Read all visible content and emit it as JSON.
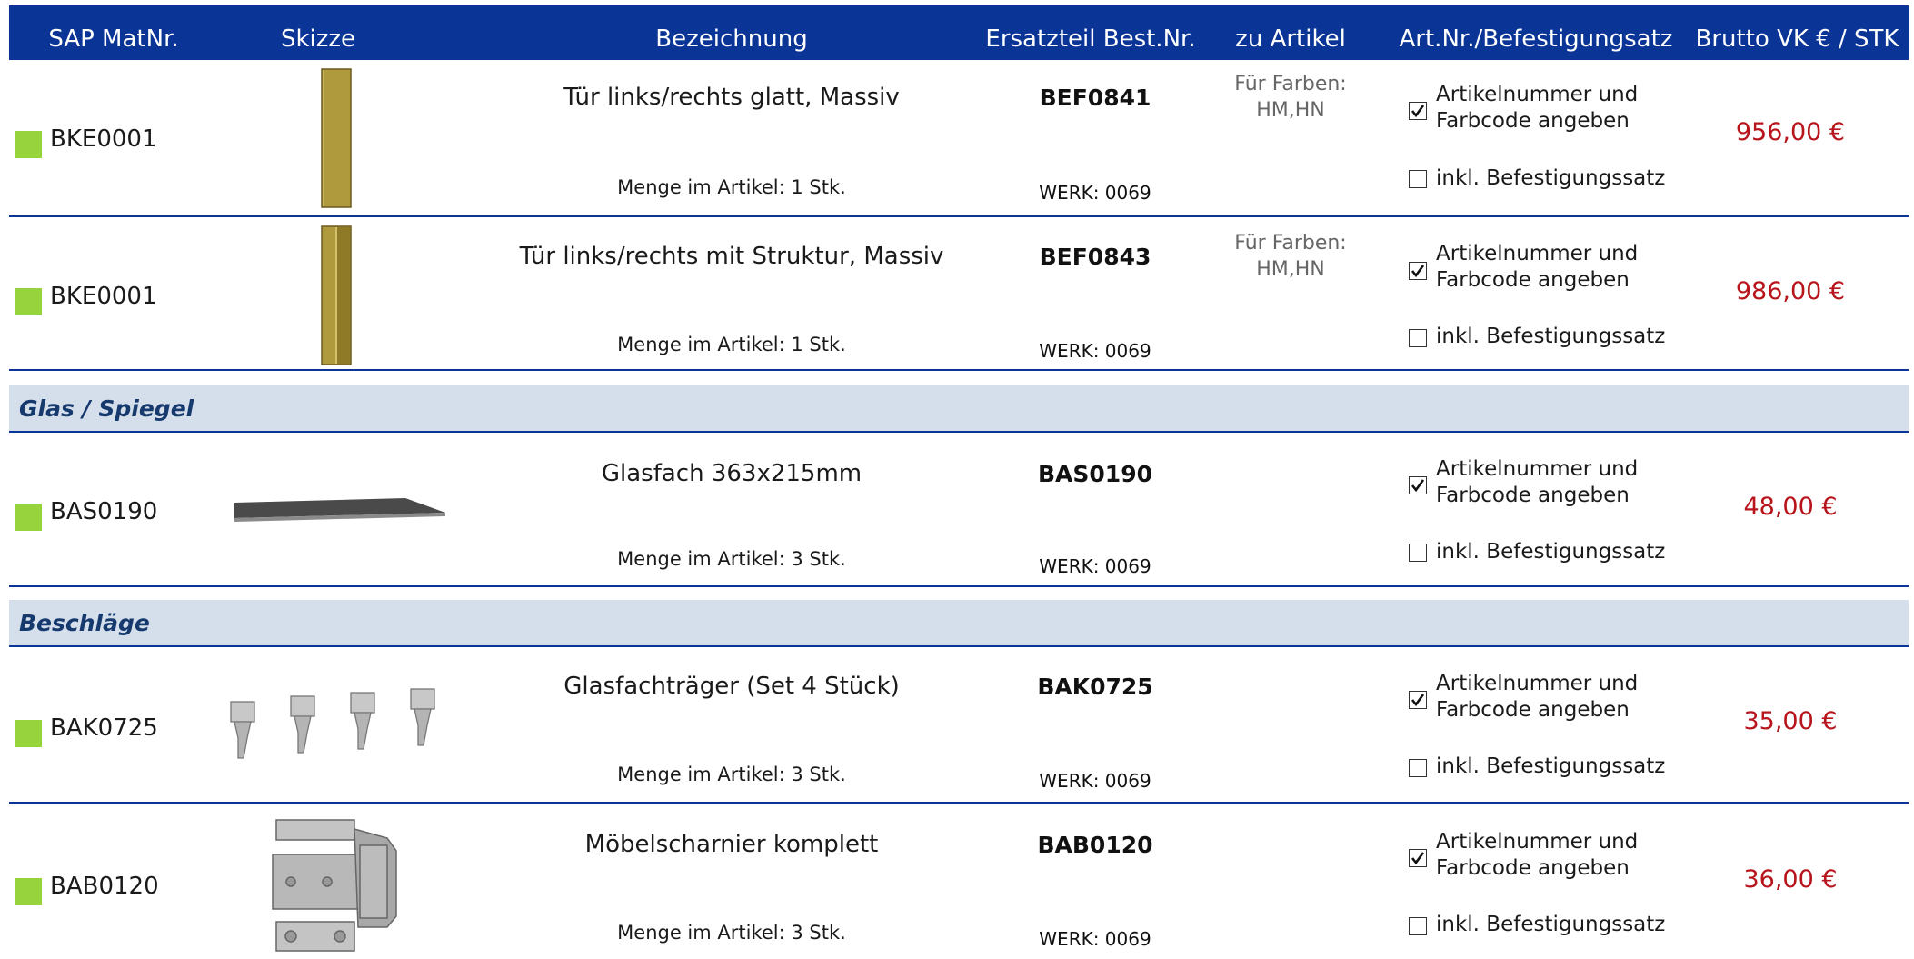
{
  "header": {
    "col_sap": "SAP MatNr.",
    "col_skizze": "Skizze",
    "col_bez": "Bezeichnung",
    "col_best": "Ersatzteil Best.Nr.",
    "col_artikel": "zu Artikel",
    "col_artnr": "Art.Nr./Befestigungsatz",
    "col_price": "Brutto VK € / STK"
  },
  "colors": {
    "header_bg": "#0a3596",
    "category_bg": "#d5dfeb",
    "status_green": "#96d33c",
    "price_red": "#b8141c"
  },
  "rows": [
    {
      "sap": "BKE0001",
      "sketch": "door-panel-icon",
      "bez": "Tür links/rechts glatt, Massiv",
      "menge": "Menge im Artikel: 1 Stk.",
      "best": "BEF0841",
      "werk": "WERK: 0069",
      "farben_1": "Für Farben:",
      "farben_2": "HM,HN",
      "opt1_line1": "Artikelnummer und",
      "opt1_line2": "Farbcode angeben",
      "opt1_checked": true,
      "opt2": "inkl. Befestigungssatz",
      "opt2_checked": false,
      "price": "956,00 €"
    },
    {
      "sap": "BKE0001",
      "sketch": "door-panel-structured-icon",
      "bez": "Tür links/rechts mit Struktur, Massiv",
      "menge": "Menge im Artikel: 1 Stk.",
      "best": "BEF0843",
      "werk": "WERK: 0069",
      "farben_1": "Für Farben:",
      "farben_2": "HM,HN",
      "opt1_line1": "Artikelnummer und",
      "opt1_line2": "Farbcode angeben",
      "opt1_checked": true,
      "opt2": "inkl. Befestigungssatz",
      "opt2_checked": false,
      "price": "986,00 €"
    },
    {
      "sap": "BAS0190",
      "sketch": "glass-shelf-icon",
      "bez": "Glasfach 363x215mm",
      "menge": "Menge im Artikel: 3 Stk.",
      "best": "BAS0190",
      "werk": "WERK: 0069",
      "opt1_line1": "Artikelnummer und",
      "opt1_line2": "Farbcode angeben",
      "opt1_checked": true,
      "opt2": "inkl. Befestigungssatz",
      "opt2_checked": false,
      "price": "48,00 €"
    },
    {
      "sap": "BAK0725",
      "sketch": "shelf-support-icon",
      "bez": "Glasfachträger (Set 4 Stück)",
      "menge": "Menge im Artikel: 3 Stk.",
      "best": "BAK0725",
      "werk": "WERK: 0069",
      "opt1_line1": "Artikelnummer und",
      "opt1_line2": "Farbcode angeben",
      "opt1_checked": true,
      "opt2": "inkl. Befestigungssatz",
      "opt2_checked": false,
      "price": "35,00 €"
    },
    {
      "sap": "BAB0120",
      "sketch": "hinge-icon",
      "bez": "Möbelscharnier komplett",
      "menge": "Menge im Artikel: 3 Stk.",
      "best": "BAB0120",
      "werk": "WERK: 0069",
      "opt1_line1": "Artikelnummer und",
      "opt1_line2": "Farbcode angeben",
      "opt1_checked": true,
      "opt2": "inkl. Befestigungssatz",
      "opt2_checked": false,
      "price": "36,00 €"
    }
  ],
  "categories": {
    "glas": "Glas / Spiegel",
    "beschlaege": "Beschläge"
  }
}
